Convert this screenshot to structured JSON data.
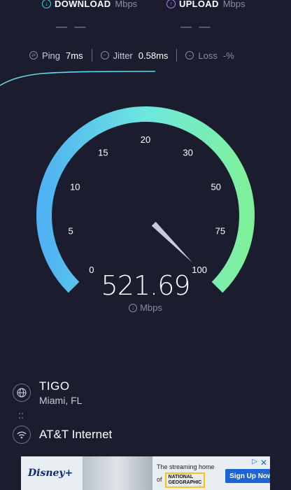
{
  "header": {
    "download": {
      "label": "DOWNLOAD",
      "unit": "Mbps",
      "value": "— —",
      "icon": "download-arrow-icon",
      "color": "#36d8e6"
    },
    "upload": {
      "label": "UPLOAD",
      "unit": "Mbps",
      "value": "— —",
      "icon": "upload-arrow-icon",
      "color": "#b77cf2"
    }
  },
  "metrics": {
    "ping": {
      "label": "Ping",
      "value": "7ms",
      "icon": "ping-icon"
    },
    "jitter": {
      "label": "Jitter",
      "value": "0.58ms",
      "icon": "jitter-icon"
    },
    "loss": {
      "label": "Loss",
      "value": "-%",
      "icon": "loss-icon"
    }
  },
  "gauge": {
    "ticks": [
      "0",
      "5",
      "10",
      "15",
      "20",
      "30",
      "50",
      "75",
      "100"
    ],
    "speed": "521.69",
    "unit": "Mbps",
    "speed_value": 521.69,
    "max_value": 100,
    "colors": {
      "start": "#4fb2f2",
      "middle": "#6ee7e0",
      "end": "#7ff09a"
    }
  },
  "provider": {
    "isp": "TIGO",
    "location": "Miami, FL",
    "connection": "AT&T Internet"
  },
  "ad": {
    "brand": "Disney+",
    "headline_1": "The streaming home",
    "headline_2": "of",
    "partner_1": "NATIONAL",
    "partner_2": "GEOGRAPHIC",
    "cta": "Sign Up Now"
  }
}
